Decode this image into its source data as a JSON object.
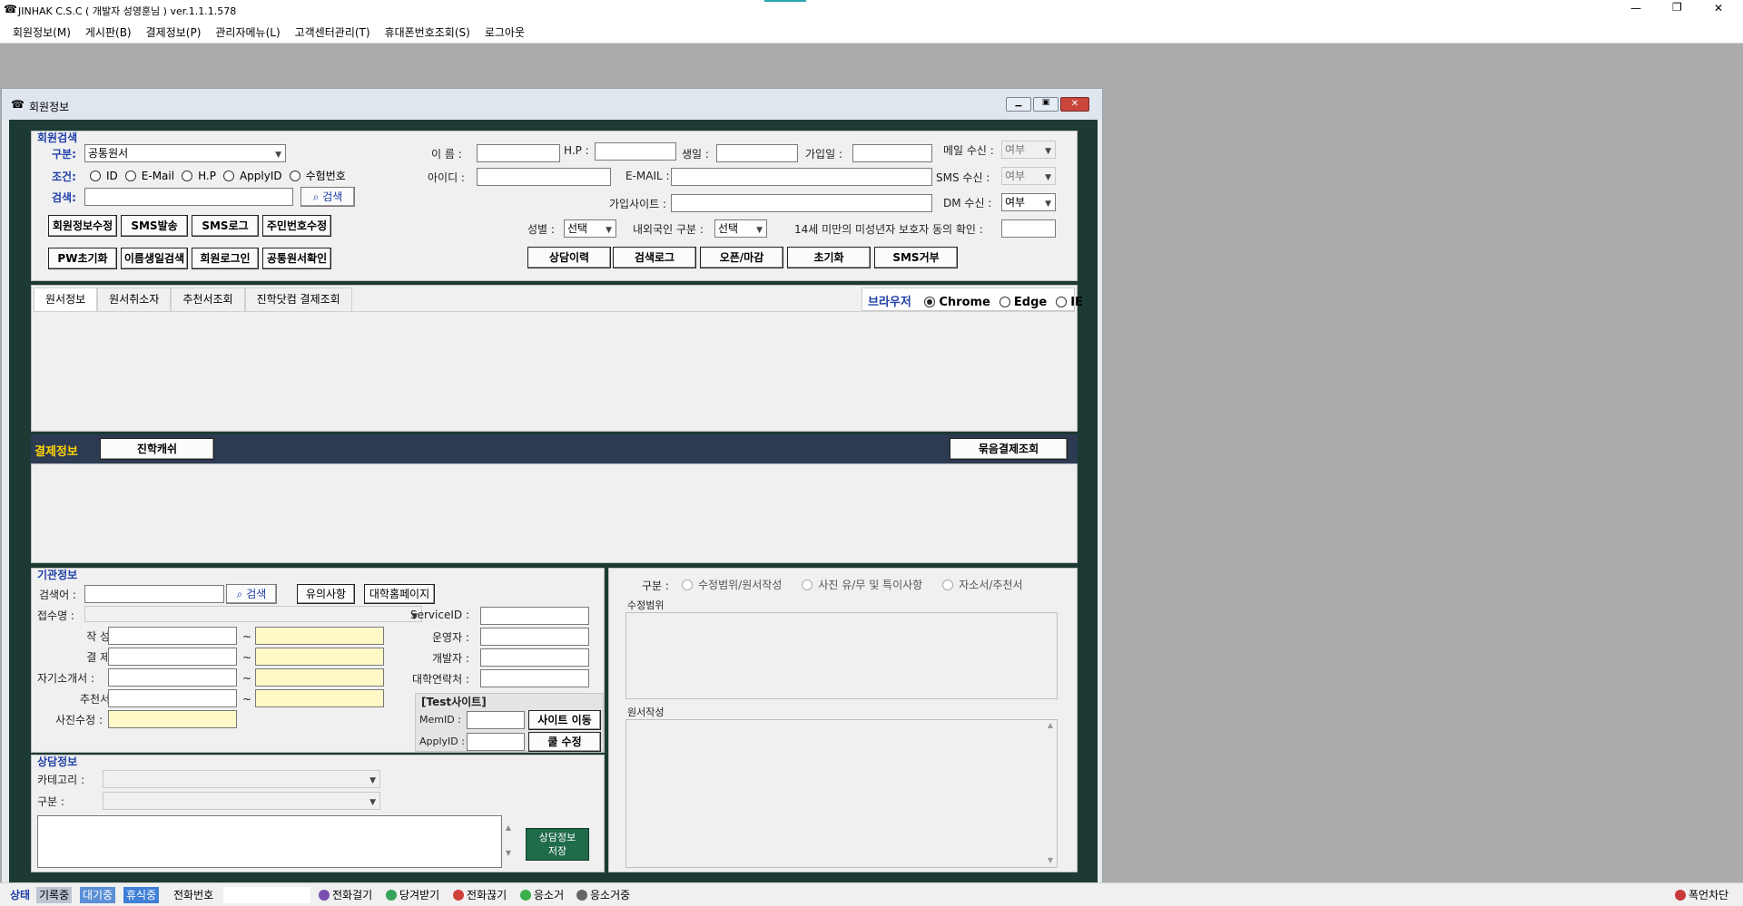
{
  "window": {
    "title": "JINHAK C.S.C ( 개발자 성영훈님 ) ver.1.1.1.578",
    "min": "—",
    "max": "❐",
    "close": "✕"
  },
  "menu": [
    "회원정보(M)",
    "게시판(B)",
    "결제정보(P)",
    "관리자메뉴(L)",
    "고객센터관리(T)",
    "휴대폰번호조회(S)",
    "로그아웃"
  ],
  "child": {
    "title": "회원정보"
  },
  "search": {
    "section": "회원검색",
    "gubun_label": "구분:",
    "gubun_value": "공통원서",
    "condition_label": "조건:",
    "conditions": [
      "ID",
      "E-Mail",
      "H.P",
      "ApplyID",
      "수험번호"
    ],
    "keyword_label": "검색:",
    "search_btn": "검색",
    "name_label": "이 름 :",
    "hp_label": "H.P :",
    "birth_label": "생일 :",
    "join_label": "가입일 :",
    "mail_recv_label": "메일 수신 :",
    "mail_recv_value": "여부",
    "id_label": "아이디 :",
    "email_label": "E-MAIL :",
    "sms_recv_label": "SMS 수신 :",
    "sms_recv_value": "여부",
    "site_label": "가입사이트 :",
    "dm_recv_label": "DM 수신 :",
    "dm_recv_value": "여부",
    "gender_label": "성별 :",
    "gender_value": "선택",
    "nation_label": "내외국인 구분 :",
    "nation_value": "선택",
    "minor_label": "14세 미만의 미성년자 보호자 동의 확인 :",
    "buttons_row1": [
      "회원정보수정",
      "SMS발송",
      "SMS로그",
      "주민번호수정"
    ],
    "buttons_row2": [
      "PW초기화",
      "이름생일검색",
      "회원로그인",
      "공통원서확인"
    ],
    "buttons_right": [
      "상담이력",
      "검색로그",
      "오픈/마감",
      "초기화",
      "SMS거부"
    ]
  },
  "tabs": [
    "원서정보",
    "원서취소자",
    "추천서조회",
    "진학닷컴 결제조회"
  ],
  "browser": {
    "label": "브라우저",
    "options": [
      "Chrome",
      "Edge",
      "IE"
    ]
  },
  "payment": {
    "label": "결제정보",
    "left_btn": "진학캐쉬",
    "right_btn": "묶음결제조회"
  },
  "org": {
    "section": "기관정보",
    "keyword_label": "검색어 :",
    "search_btn": "검색",
    "notice_btn": "유의사항",
    "univ_btn": "대학홈페이지",
    "reception_label": "접수명 :",
    "rows": [
      "작 성 :",
      "결 제 :",
      "자기소개서 :",
      "추천서 :",
      "사진수정 :"
    ],
    "tilde": "~",
    "right_labels": [
      "ServiceID :",
      "운영자 :",
      "개발자 :",
      "대학연락처 :"
    ],
    "test_label": "[Test사이트]",
    "memid_label": "MemID :",
    "applyid_label": "ApplyID :",
    "site_move_btn": "사이트 이동",
    "cookie_btn": "쿨 수정"
  },
  "consult": {
    "section": "상담정보",
    "category_label": "카테고리 :",
    "gubun_label": "구분 :",
    "save_btn_line1": "상담정보",
    "save_btn_line2": "저장"
  },
  "edit": {
    "gubun_label": "구분 :",
    "options": [
      "수정범위/원서작성",
      "사진 유/무 및 특이사항",
      "자소서/추천서"
    ],
    "range_label": "수정범위",
    "write_label": "원서작성"
  },
  "status": {
    "items": [
      "상태",
      "기록중",
      "대기중",
      "휴식중",
      "전화번호"
    ],
    "actions": [
      "전화걸기",
      "당겨받기",
      "전화끊기",
      "응소거",
      "응소거중"
    ],
    "block": "폭언차단"
  },
  "colors": {
    "frame": "#1c3a33",
    "dark_bar": "#2c3a52",
    "save_btn": "#1f6b4a",
    "accent": "#1f3fa8"
  }
}
